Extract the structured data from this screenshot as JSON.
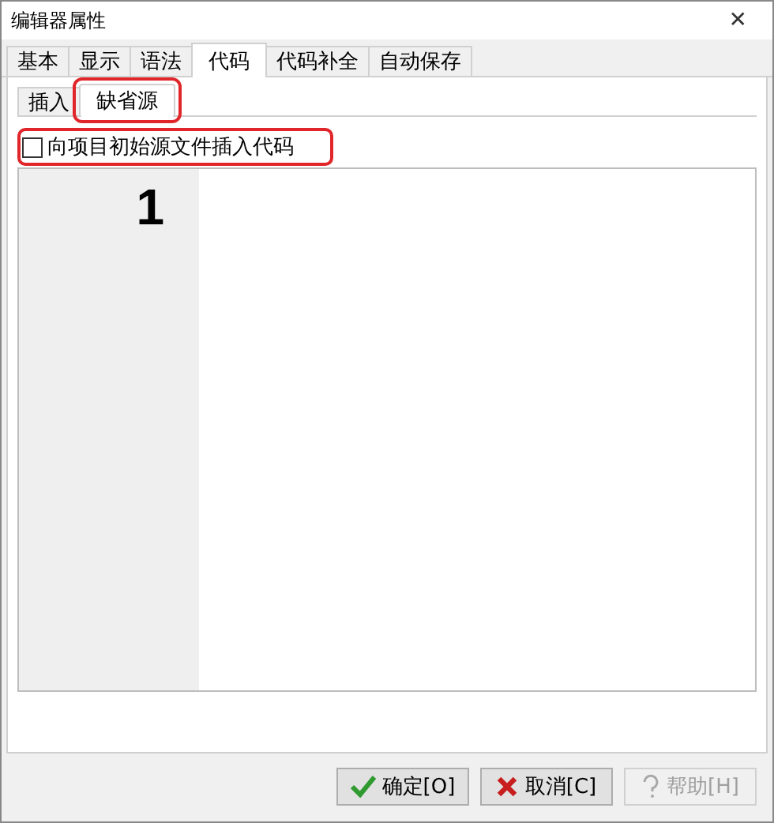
{
  "window": {
    "title": "编辑器属性",
    "close": "✕"
  },
  "tabs": [
    {
      "label": "基本",
      "selected": false
    },
    {
      "label": "显示",
      "selected": false
    },
    {
      "label": "语法",
      "selected": false
    },
    {
      "label": "代码",
      "selected": true
    },
    {
      "label": "代码补全",
      "selected": false
    },
    {
      "label": "自动保存",
      "selected": false
    }
  ],
  "subtabs": [
    {
      "label": "插入",
      "selected": false,
      "highlighted": false
    },
    {
      "label": "缺省源",
      "selected": true,
      "highlighted": true
    }
  ],
  "option": {
    "label": "向项目初始源文件插入代码",
    "checked": false,
    "highlighted": true
  },
  "editor": {
    "line_numbers": [
      "1"
    ]
  },
  "buttons": [
    {
      "label": "确定[O]",
      "kind": "ok",
      "disabled": false
    },
    {
      "label": "取消[C]",
      "kind": "cancel",
      "disabled": false
    },
    {
      "label": "帮助[H]",
      "kind": "help",
      "disabled": true
    }
  ]
}
